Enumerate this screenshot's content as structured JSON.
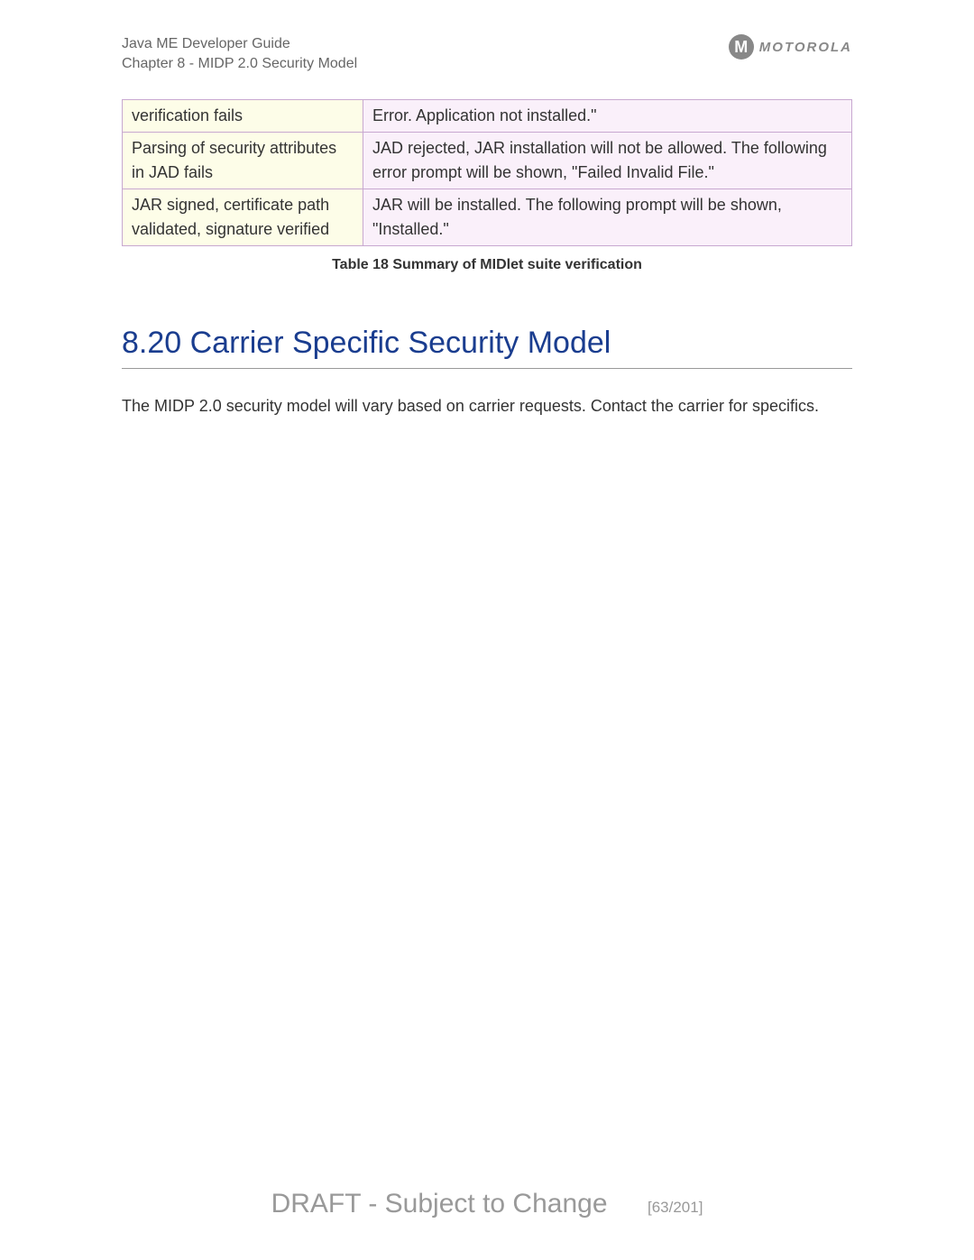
{
  "header": {
    "guide_title": "Java ME Developer Guide",
    "chapter_line": "Chapter 8 - MIDP 2.0 Security Model",
    "brand": "MOTOROLA"
  },
  "table": {
    "rows": [
      {
        "col1": "verification fails",
        "col2": "Error. Application not installed.\""
      },
      {
        "col1": "Parsing of security attributes in JAD fails",
        "col2": "JAD rejected, JAR installation will not be allowed. The following error prompt will be shown, \"Failed Invalid File.\""
      },
      {
        "col1": "JAR signed, certificate path validated, signature verified",
        "col2": "JAR will be installed. The following prompt will be shown, \"Installed.\""
      }
    ],
    "caption": "Table 18 Summary of MIDlet suite verification"
  },
  "section": {
    "heading": "8.20 Carrier Specific Security Model",
    "body": "The MIDP 2.0 security model will vary based on carrier requests. Contact the carrier for specifics."
  },
  "footer": {
    "draft": "DRAFT - Subject to Change",
    "page": "[63/201]"
  }
}
